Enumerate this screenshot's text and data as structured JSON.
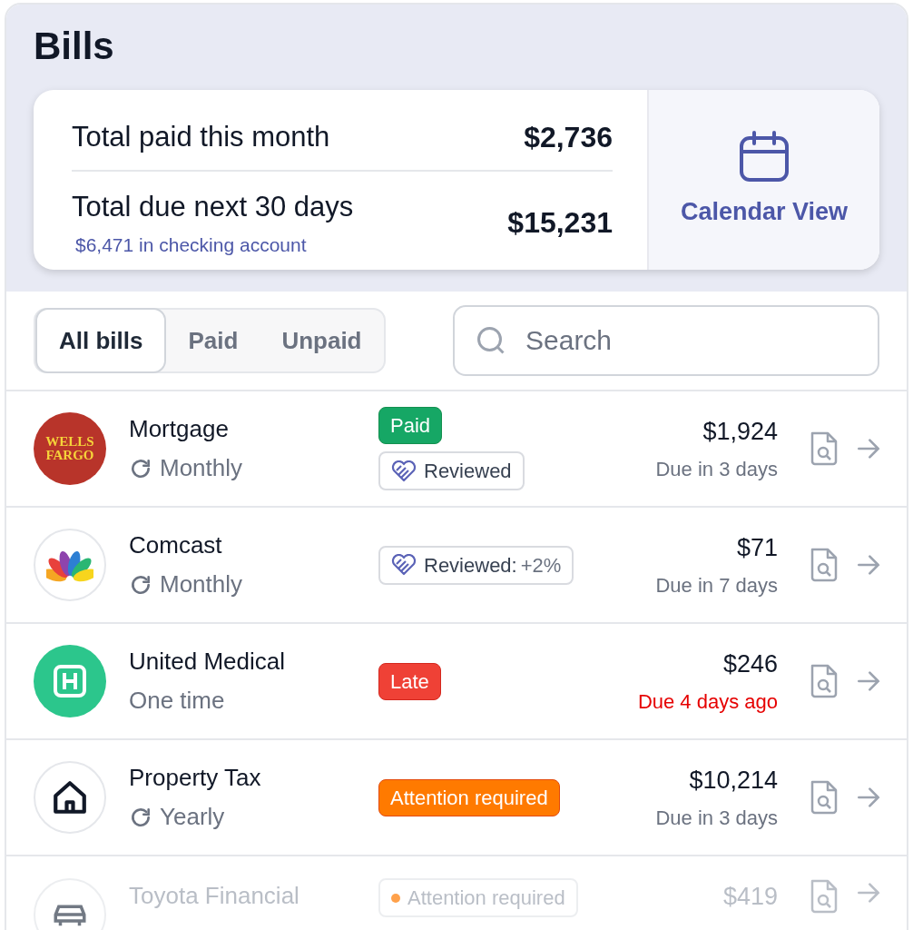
{
  "title": "Bills",
  "summary": {
    "rows": [
      {
        "label": "Total paid this month",
        "value": "$2,736"
      },
      {
        "label": "Total due next 30 days",
        "value": "$15,231",
        "note": "$6,471 in checking account"
      }
    ],
    "calendar_button": "Calendar View"
  },
  "tabs": [
    {
      "label": "All bills",
      "selected": true
    },
    {
      "label": "Paid",
      "selected": false
    },
    {
      "label": "Unpaid",
      "selected": false
    }
  ],
  "search": {
    "placeholder": "Search"
  },
  "bills": [
    {
      "logo": {
        "kind": "wells",
        "text": [
          "WELLS",
          "FARGO"
        ]
      },
      "name": "Mortgage",
      "frequency": "Monthly",
      "recurring": true,
      "badges": [
        {
          "kind": "paid",
          "label": "Paid"
        },
        {
          "kind": "reviewed",
          "label": "Reviewed"
        }
      ],
      "amount": "$1,924",
      "due": "Due in 3 days",
      "overdue": false,
      "faded": false
    },
    {
      "logo": {
        "kind": "peacock"
      },
      "name": "Comcast",
      "frequency": "Monthly",
      "recurring": true,
      "badges": [
        {
          "kind": "reviewed",
          "label": "Reviewed:",
          "note": "+2%"
        }
      ],
      "amount": "$71",
      "due": "Due in 7 days",
      "overdue": false,
      "faded": false
    },
    {
      "logo": {
        "kind": "hospital"
      },
      "name": "United Medical",
      "frequency": "One time",
      "recurring": false,
      "badges": [
        {
          "kind": "late",
          "label": "Late"
        }
      ],
      "amount": "$246",
      "due": "Due 4 days ago",
      "overdue": true,
      "faded": false
    },
    {
      "logo": {
        "kind": "house"
      },
      "name": "Property Tax",
      "frequency": "Yearly",
      "recurring": true,
      "badges": [
        {
          "kind": "attention",
          "label": "Attention required"
        }
      ],
      "amount": "$10,214",
      "due": "Due in 3 days",
      "overdue": false,
      "faded": false
    },
    {
      "logo": {
        "kind": "car"
      },
      "name": "Toyota Financial",
      "badges": [
        {
          "kind": "attention-soft",
          "label": "Attention required"
        }
      ],
      "amount": "$419",
      "faded": true
    }
  ]
}
